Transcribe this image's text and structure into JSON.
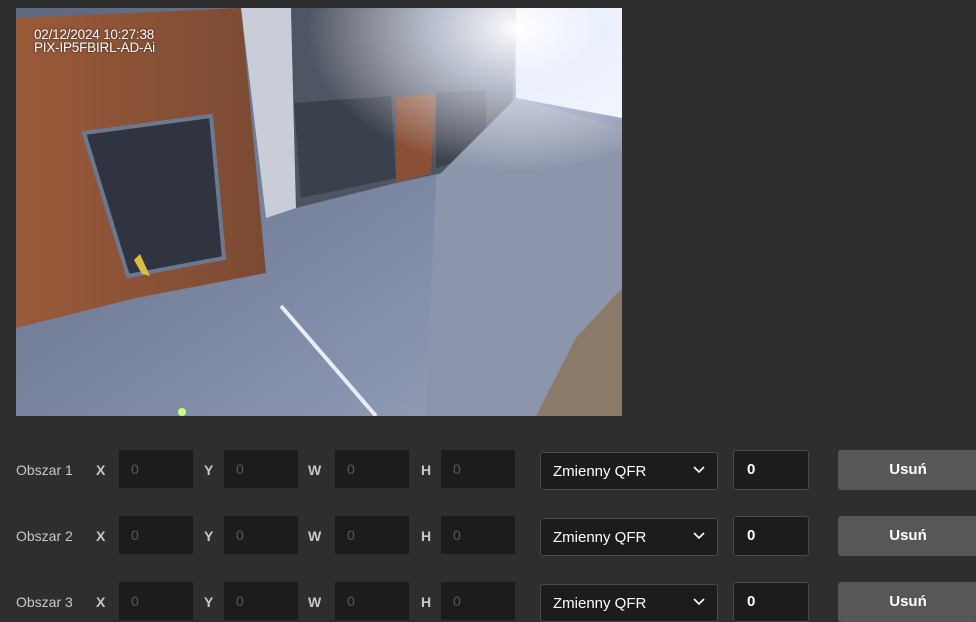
{
  "camera": {
    "timestamp": "02/12/2024  10:27:38",
    "name": "PIX-IP5FBIRL-AD-Ai"
  },
  "regions": [
    {
      "label": "Obszar 1",
      "x_label": "X",
      "x": "0",
      "y_label": "Y",
      "y": "0",
      "w_label": "W",
      "w": "0",
      "h_label": "H",
      "h": "0",
      "mode": "Zmienny QFR",
      "value": "0",
      "delete": "Usuń"
    },
    {
      "label": "Obszar 2",
      "x_label": "X",
      "x": "0",
      "y_label": "Y",
      "y": "0",
      "w_label": "W",
      "w": "0",
      "h_label": "H",
      "h": "0",
      "mode": "Zmienny QFR",
      "value": "0",
      "delete": "Usuń"
    },
    {
      "label": "Obszar 3",
      "x_label": "X",
      "x": "0",
      "y_label": "Y",
      "y": "0",
      "w_label": "W",
      "w": "0",
      "h_label": "H",
      "h": "0",
      "mode": "Zmienny QFR",
      "value": "0",
      "delete": "Usuń"
    }
  ]
}
